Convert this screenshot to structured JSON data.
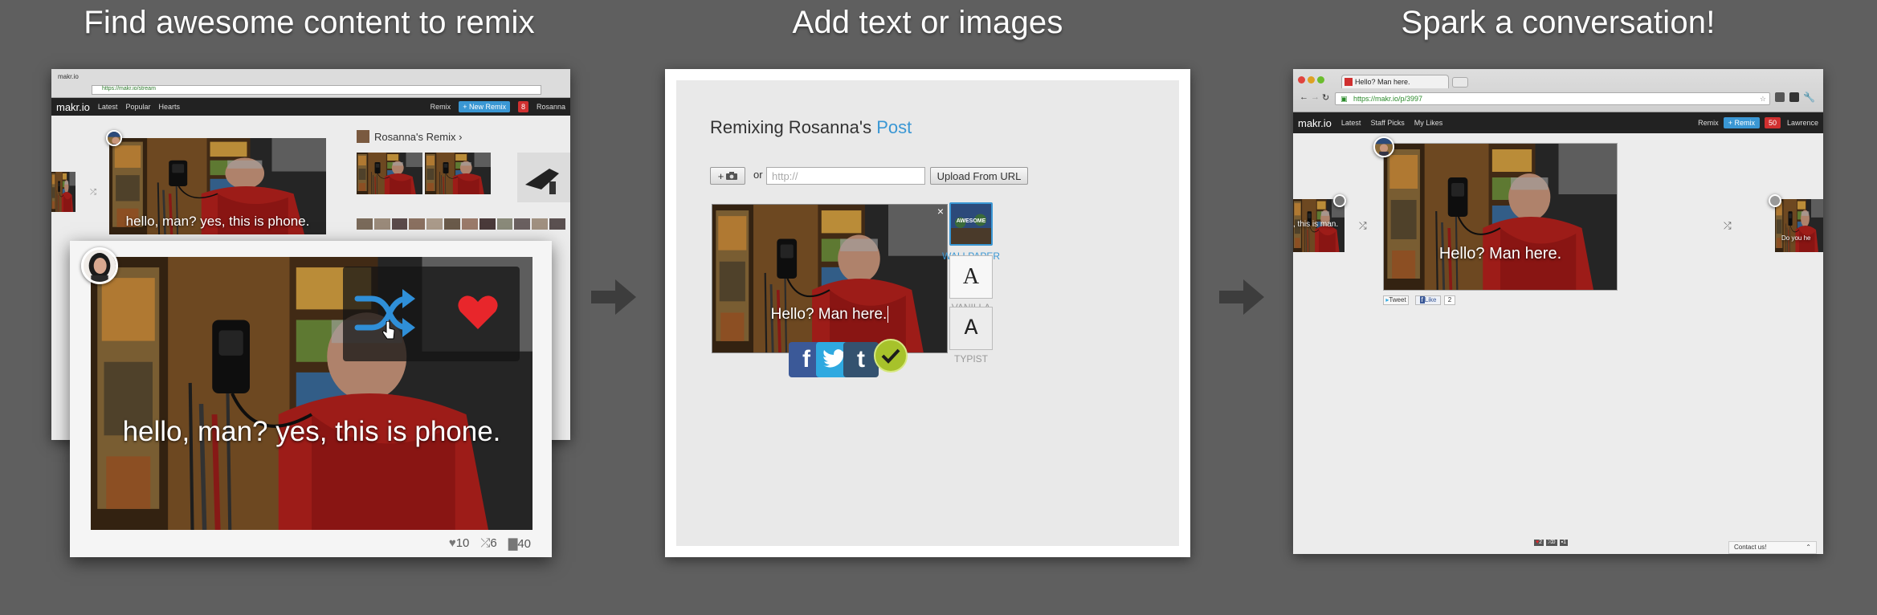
{
  "headlines": {
    "panel1": "Find awesome content to remix",
    "panel2": "Add text or images",
    "panel3": "Spark a conversation!"
  },
  "panel1": {
    "browser_tab": "makr.io",
    "url": "https://makr.io/stream",
    "nav": {
      "logo": "makr.io",
      "items": [
        "Latest",
        "Popular",
        "Hearts"
      ],
      "remix": "Remix",
      "new_remix": "+ New Remix",
      "notif_count": "8",
      "user": "Rosanna"
    },
    "remix_header": "Rosanna's Remix ›",
    "small_caption": "hello, man?  yes, this is phone.",
    "card": {
      "caption": "hello, man?  yes, this is phone.",
      "stats": {
        "hearts": "10",
        "remixes": "6",
        "comments": "40"
      },
      "icons": [
        "shuffle-icon",
        "heart-icon",
        "pointer-hand-icon"
      ]
    }
  },
  "panel2": {
    "title_prefix": "Remixing Rosanna's ",
    "title_link": "Post",
    "camera_button": "+",
    "or_label": "or",
    "url_placeholder": "http://",
    "upload_button": "Upload From URL",
    "image_caption": "Hello? Man here.",
    "close": "×",
    "styles": [
      {
        "name": "WALLPAPER",
        "thumb_text": "AWESOME",
        "selected": true
      },
      {
        "name": "VANILLA",
        "glyph": "A",
        "selected": false
      },
      {
        "name": "TYPIST",
        "glyph": "A",
        "selected": false
      }
    ],
    "share_buttons": [
      "facebook-icon",
      "twitter-icon",
      "tumblr-icon",
      "check-icon"
    ]
  },
  "panel3": {
    "tab_title": "Hello? Man here.",
    "url": "https://makr.io/p/3997",
    "nav": {
      "logo": "makr.io",
      "items": [
        "Latest",
        "Staff Picks",
        "My Likes"
      ],
      "remix": "Remix",
      "new_remix": "+ Remix",
      "notif_count": "50",
      "user": "Lawrence"
    },
    "main_caption": "Hello? Man here.",
    "left_caption": ", this is man.",
    "right_caption": "Do you he",
    "social": {
      "tweet": "Tweet",
      "like": "Like",
      "like_count": "2"
    },
    "footer_stats": {
      "hearts": "2",
      "remixes": "0",
      "comments": "1"
    },
    "contact": "Contact us!"
  },
  "colors": {
    "background": "#5f5f5f",
    "accent_blue": "#3a97d4",
    "heart_red": "#e8262b",
    "check_green": "#a7c22b",
    "facebook": "#3b5998",
    "twitter": "#2fa9e0",
    "tumblr": "#34526f"
  }
}
